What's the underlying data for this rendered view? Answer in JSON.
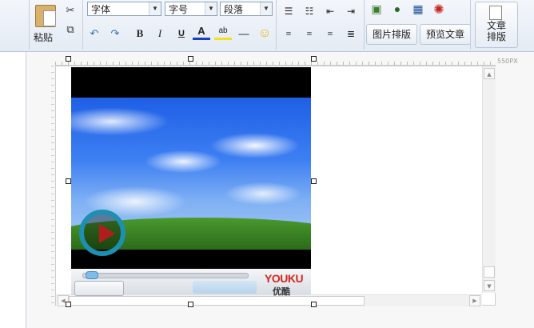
{
  "toolbar": {
    "paste_label": "粘贴",
    "font_select": "字体",
    "size_select": "字号",
    "paragraph_select": "段落",
    "picture_layout_label": "图片排版",
    "preview_label": "预览文章",
    "article_layout_label": "文章\n排版"
  },
  "editor": {
    "ruler_width_label": "550PX"
  },
  "video": {
    "brand": "YOUKU",
    "brand_cn": "优酷"
  },
  "colors": {
    "toolbar_bg": "#e4ebf4",
    "brand_red": "#d5261c",
    "play_ring": "#1d8fb0"
  }
}
